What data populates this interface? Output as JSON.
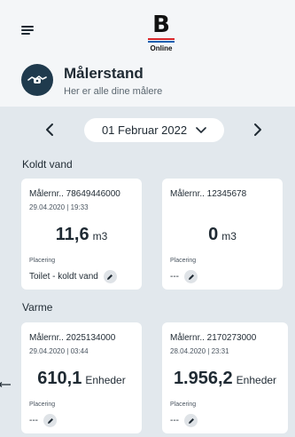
{
  "app": {
    "logo_letter": "B",
    "logo_sub": "Online"
  },
  "header": {
    "title": "Målerstand",
    "subtitle": "Her er alle dine målere"
  },
  "date_nav": {
    "date": "01 Februar 2022"
  },
  "sections": [
    {
      "label": "Koldt vand",
      "cards": [
        {
          "meter": "Målernr.. 78649446000",
          "date": "29.04.2020 | 19:33",
          "value": "11,6",
          "unit": "m3",
          "placement_label": "Placering",
          "placement": "Toilet - koldt vand"
        },
        {
          "meter": "Målernr.. 12345678",
          "date": "",
          "value": "0",
          "unit": "m3",
          "placement_label": "Placering",
          "placement": "---"
        }
      ]
    },
    {
      "label": "Varme",
      "cards": [
        {
          "meter": "Målernr.. 2025134000",
          "date": "29.04.2020 | 03:44",
          "value": "610,1",
          "unit": "Enheder",
          "placement_label": "Placering",
          "placement": "---"
        },
        {
          "meter": "Målernr.. 2170273000",
          "date": "28.04.2020 | 23:31",
          "value": "1.956,2",
          "unit": "Enheder",
          "placement_label": "Placering",
          "placement": "---"
        }
      ]
    }
  ],
  "icons": {
    "menu": "hamburger-menu-icon",
    "avatar": "meter-icon",
    "prev": "chevron-left-icon",
    "next": "chevron-right-icon",
    "dropdown": "chevron-down-icon",
    "edit": "pencil-icon"
  },
  "colors": {
    "background": "#e2e8ed",
    "header": "#f4f6f8",
    "avatar": "#1f3a4d",
    "logo_red": "#d8252a",
    "logo_blue": "#1f5fb0"
  }
}
